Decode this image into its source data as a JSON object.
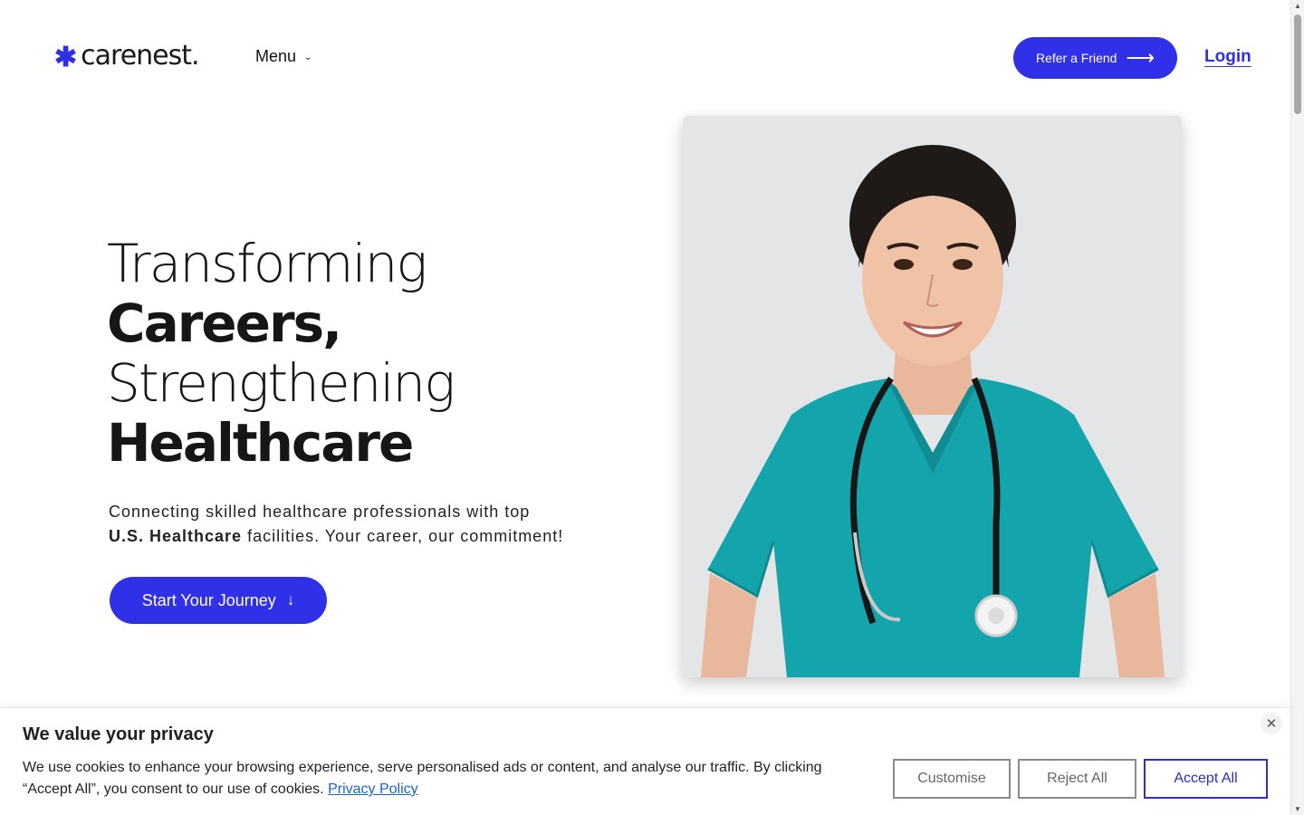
{
  "header": {
    "logo_mark": "✱",
    "logo_text": "carenest.",
    "menu_label": "Menu",
    "menu_chevron": "⌄",
    "refer_label": "Refer a Friend",
    "refer_arrow": "⟶",
    "login_label": "Login"
  },
  "hero": {
    "headline": [
      "Transforming",
      "Careers,",
      "Strengthening",
      "Healthcare"
    ],
    "subtitle_part1": "Connecting skilled healthcare professionals with top",
    "subtitle_bold": "U.S. Healthcare",
    "subtitle_part2": "facilities. Your career, our commitment!",
    "cta_label": "Start Your Journey",
    "cta_arrow": "↓"
  },
  "cookie": {
    "title": "We value your privacy",
    "text": "We use cookies to enhance your browsing experience, serve personalised ads or content, and analyse our traffic. By clicking “Accept All”, you consent to our use of cookies.",
    "privacy_link": "Privacy Policy",
    "close_glyph": "✕",
    "customise_label": "Customise",
    "reject_label": "Reject All",
    "accept_label": "Accept All"
  },
  "scrollbar": {
    "up": "▲",
    "down": "▼"
  },
  "colors": {
    "brand": "#3030e8",
    "text": "#1c1c1c",
    "link": "#1863dc",
    "scrubs": "#14a5ac"
  },
  "icons": [
    "asterisk-logo-icon",
    "chevron-down-icon",
    "arrow-right-icon",
    "arrow-down-icon",
    "close-icon"
  ]
}
